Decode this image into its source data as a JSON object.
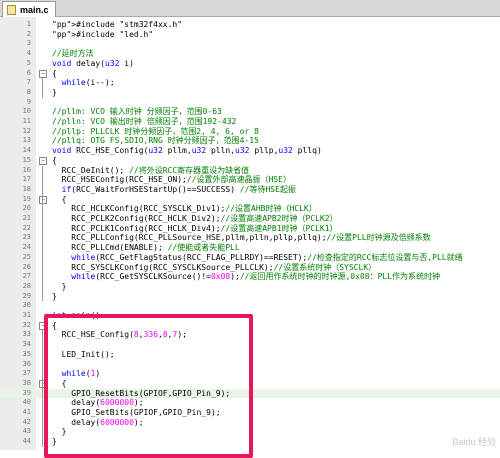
{
  "tab": {
    "filename": "main.c",
    "icon": "c-file-icon"
  },
  "lines": [
    {
      "n": "1",
      "t": "#include \"stm32f4xx.h\""
    },
    {
      "n": "2",
      "t": "#include \"led.h\""
    },
    {
      "n": "3",
      "t": ""
    },
    {
      "n": "4",
      "t": "//延时方法"
    },
    {
      "n": "5",
      "t": "void delay(u32 i)"
    },
    {
      "n": "6",
      "t": "{"
    },
    {
      "n": "7",
      "t": "  while(i--);"
    },
    {
      "n": "8",
      "t": "}"
    },
    {
      "n": "9",
      "t": ""
    },
    {
      "n": "10",
      "t": "//pllm: VCO 输入时钟 分频因子，范围0-63"
    },
    {
      "n": "11",
      "t": "//plln: VCO 输出时钟 倍频因子，范围192-432"
    },
    {
      "n": "12",
      "t": "//pllp: PLLCLK 时钟分频因子，范围2, 4, 6, or 8"
    },
    {
      "n": "13",
      "t": "//pllq: OTG FS,SDIO,RNG 时钟分频因子，范围4-15"
    },
    {
      "n": "14",
      "t": "void RCC_HSE_Config(u32 pllm,u32 plln,u32 pllp,u32 pllq)"
    },
    {
      "n": "15",
      "t": "{"
    },
    {
      "n": "16",
      "t": "  RCC_DeInit(); //将外设RCC寄存器重设为缺省值"
    },
    {
      "n": "17",
      "t": "  RCC_HSEConfig(RCC_HSE_ON);//设置外部高速晶振（HSE）"
    },
    {
      "n": "18",
      "t": "  if(RCC_WaitForHSEStartUp()==SUCCESS) //等待HSE起振"
    },
    {
      "n": "19",
      "t": "  {"
    },
    {
      "n": "20",
      "t": "    RCC_HCLKConfig(RCC_SYSCLK_Div1);//设置AHB时钟（HCLK）"
    },
    {
      "n": "21",
      "t": "    RCC_PCLK2Config(RCC_HCLK_Div2);//设置高速APB2时钟（PCLK2）"
    },
    {
      "n": "22",
      "t": "    RCC_PCLK1Config(RCC_HCLK_Div4);//设置高速APB1时钟（PCLK1）"
    },
    {
      "n": "23",
      "t": "    RCC_PLLConfig(RCC_PLLSource_HSE,pllm,plln,pllp,pllq);//设置PLL时钟源及倍频系数"
    },
    {
      "n": "24",
      "t": "    RCC_PLLCmd(ENABLE); //使能或者失能PLL"
    },
    {
      "n": "25",
      "t": "    while(RCC_GetFlagStatus(RCC_FLAG_PLLRDY)==RESET);//检查指定的RCC标志位设置与否,PLL就绪"
    },
    {
      "n": "26",
      "t": "    RCC_SYSCLKConfig(RCC_SYSCLKSource_PLLCLK);//设置系统时钟（SYSCLK）"
    },
    {
      "n": "27",
      "t": "    while(RCC_GetSYSCLKSource()!=0x08);//返回用作系统时钟的时钟源,0x08：PLL作为系统时钟"
    },
    {
      "n": "28",
      "t": "  }"
    },
    {
      "n": "29",
      "t": "}"
    },
    {
      "n": "30",
      "t": ""
    },
    {
      "n": "31",
      "t": "int main()"
    },
    {
      "n": "32",
      "t": "{"
    },
    {
      "n": "33",
      "t": "  RCC_HSE_Config(8,336,8,7);"
    },
    {
      "n": "34",
      "t": ""
    },
    {
      "n": "35",
      "t": "  LED_Init();"
    },
    {
      "n": "36",
      "t": ""
    },
    {
      "n": "37",
      "t": "  while(1)"
    },
    {
      "n": "38",
      "t": "  {"
    },
    {
      "n": "39",
      "t": "    GPIO_ResetBits(GPIOF,GPIO_Pin_9);"
    },
    {
      "n": "40",
      "t": "    delay(6000000);"
    },
    {
      "n": "41",
      "t": "    GPIO_SetBits(GPIOF,GPIO_Pin_9);"
    },
    {
      "n": "42",
      "t": "    delay(6000000);"
    },
    {
      "n": "43",
      "t": "  }"
    },
    {
      "n": "44",
      "t": "}"
    }
  ],
  "watermark": "Baidu 经验",
  "colors": {
    "highlight_box": "#e8175d",
    "comment": "#008000",
    "keyword": "#0000ff"
  }
}
